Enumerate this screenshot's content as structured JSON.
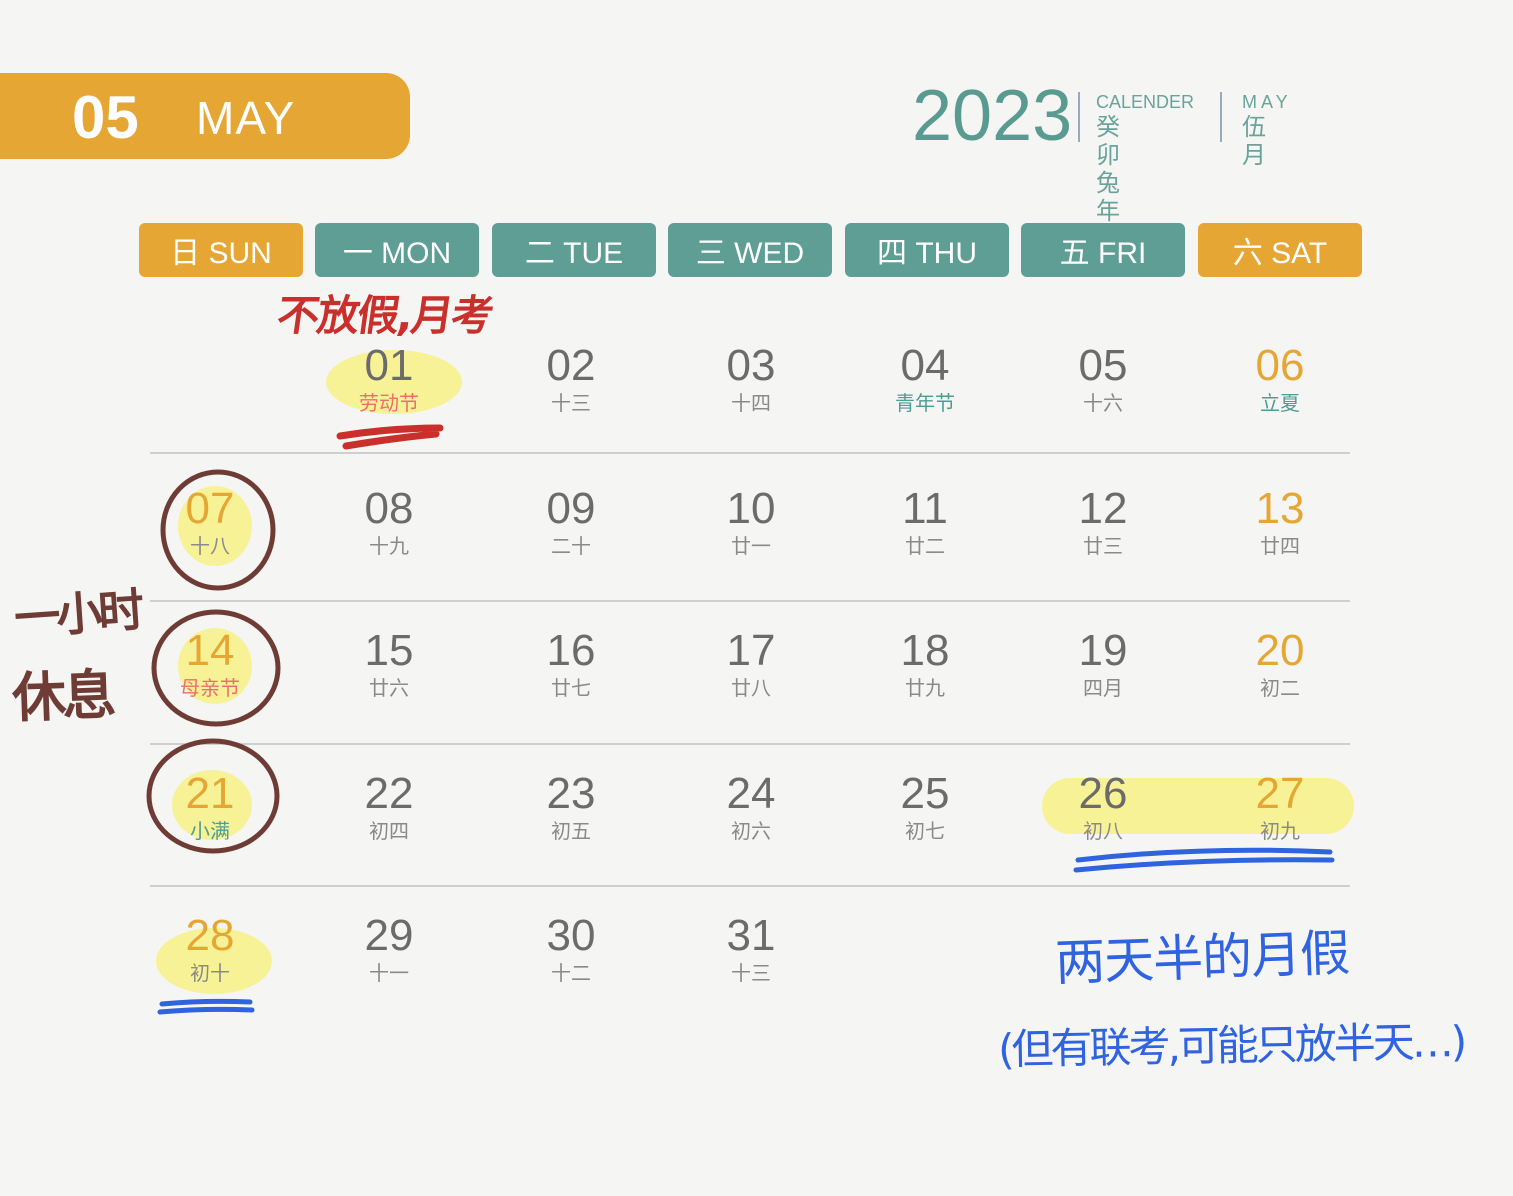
{
  "banner": {
    "month_number": "05",
    "month_name": "MAY"
  },
  "header": {
    "year": "2023",
    "calendar_label": "CALENDER",
    "zodiac_year": "癸卯兔年",
    "month_en": "MAY",
    "month_cn": "伍月"
  },
  "weekdays": [
    {
      "label": "日 SUN",
      "weekend": true
    },
    {
      "label": "一 MON",
      "weekend": false
    },
    {
      "label": "二 TUE",
      "weekend": false
    },
    {
      "label": "三 WED",
      "weekend": false
    },
    {
      "label": "四 THU",
      "weekend": false
    },
    {
      "label": "五 FRI",
      "weekend": false
    },
    {
      "label": "六 SAT",
      "weekend": true
    }
  ],
  "weeks": [
    [
      null,
      {
        "day": "01",
        "lunar": "劳动节",
        "style": "festival-red"
      },
      {
        "day": "02",
        "lunar": "十三"
      },
      {
        "day": "03",
        "lunar": "十四"
      },
      {
        "day": "04",
        "lunar": "青年节",
        "style": "festival-teal"
      },
      {
        "day": "05",
        "lunar": "十六"
      },
      {
        "day": "06",
        "lunar": "立夏",
        "style": "festival-teal"
      }
    ],
    [
      {
        "day": "07",
        "lunar": "十八"
      },
      {
        "day": "08",
        "lunar": "十九"
      },
      {
        "day": "09",
        "lunar": "二十"
      },
      {
        "day": "10",
        "lunar": "廿一"
      },
      {
        "day": "11",
        "lunar": "廿二"
      },
      {
        "day": "12",
        "lunar": "廿三"
      },
      {
        "day": "13",
        "lunar": "廿四"
      }
    ],
    [
      {
        "day": "14",
        "lunar": "母亲节",
        "style": "festival-red"
      },
      {
        "day": "15",
        "lunar": "廿六"
      },
      {
        "day": "16",
        "lunar": "廿七"
      },
      {
        "day": "17",
        "lunar": "廿八"
      },
      {
        "day": "18",
        "lunar": "廿九"
      },
      {
        "day": "19",
        "lunar": "四月"
      },
      {
        "day": "20",
        "lunar": "初二"
      }
    ],
    [
      {
        "day": "21",
        "lunar": "小满",
        "style": "festival-teal"
      },
      {
        "day": "22",
        "lunar": "初四"
      },
      {
        "day": "23",
        "lunar": "初五"
      },
      {
        "day": "24",
        "lunar": "初六"
      },
      {
        "day": "25",
        "lunar": "初七"
      },
      {
        "day": "26",
        "lunar": "初八"
      },
      {
        "day": "27",
        "lunar": "初九"
      }
    ],
    [
      {
        "day": "28",
        "lunar": "初十"
      },
      {
        "day": "29",
        "lunar": "十一"
      },
      {
        "day": "30",
        "lunar": "十二"
      },
      {
        "day": "31",
        "lunar": "十三"
      },
      null,
      null,
      null
    ]
  ],
  "annotations": {
    "red_note": "不放假,月考",
    "brown_note_line1": "一小时",
    "brown_note_line2": "休息",
    "blue_note_line1": "两天半的月假",
    "blue_note_line2": "(但有联考,可能只放半天…)"
  },
  "colors": {
    "accent_orange": "#e6a634",
    "accent_teal": "#5e9e94",
    "ink_red": "#c9302c",
    "ink_brown": "#6e3b35",
    "ink_blue": "#2f63df",
    "highlighter": "#f8f078"
  }
}
